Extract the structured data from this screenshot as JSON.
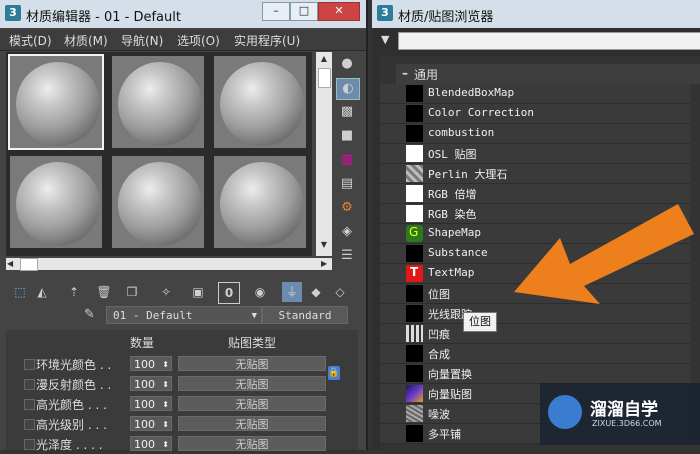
{
  "material_editor": {
    "title": "材质编辑器 - 01 - Default",
    "app_icon": "3",
    "menus": [
      "模式(D)",
      "材质(M)",
      "导航(N)",
      "选项(O)",
      "实用程序(U)"
    ],
    "material_name": "01 - Default",
    "material_type": "Standard",
    "params_header": {
      "amount": "数量",
      "map_type": "贴图类型"
    },
    "params": [
      {
        "label": "环境光颜色 . .",
        "amount": "100",
        "map": "无贴图"
      },
      {
        "label": "漫反射颜色 . .",
        "amount": "100",
        "map": "无贴图"
      },
      {
        "label": "高光颜色 . . .",
        "amount": "100",
        "map": "无贴图"
      },
      {
        "label": "高光级别 . . .",
        "amount": "100",
        "map": "无贴图"
      },
      {
        "label": "光泽度 . . . .",
        "amount": "100",
        "map": "无贴图"
      }
    ],
    "side_tools": [
      "sphere-icon",
      "backlight-icon",
      "checker-background-icon",
      "sample-uv-icon",
      "video-color-icon",
      "make-preview-icon",
      "options-icon",
      "select-by-material-icon",
      "material-navigator-icon"
    ],
    "toolbar_glyph": "0"
  },
  "browser": {
    "title": "材质/贴图浏览器",
    "app_icon": "3",
    "search_value": "",
    "category": "通用",
    "items": [
      {
        "label": "BlendedBoxMap",
        "icon": "black"
      },
      {
        "label": "Color Correction",
        "icon": "black"
      },
      {
        "label": "combustion",
        "icon": "black"
      },
      {
        "label": "OSL 贴图",
        "icon": "white"
      },
      {
        "label": "Perlin 大理石",
        "icon": "marble"
      },
      {
        "label": "RGB 倍增",
        "icon": "white"
      },
      {
        "label": "RGB 染色",
        "icon": "white"
      },
      {
        "label": "ShapeMap",
        "icon": "shapemap"
      },
      {
        "label": "Substance",
        "icon": "black"
      },
      {
        "label": "TextMap",
        "icon": "textmap"
      },
      {
        "label": "位图",
        "icon": "black"
      },
      {
        "label": "光线跟踪",
        "icon": "black"
      },
      {
        "label": "凹痕",
        "icon": "dent"
      },
      {
        "label": "合成",
        "icon": "black"
      },
      {
        "label": "向量置换",
        "icon": "black"
      },
      {
        "label": "向量贴图",
        "icon": "vector"
      },
      {
        "label": "噪波",
        "icon": "noise"
      },
      {
        "label": "多平铺",
        "icon": "black"
      }
    ],
    "tooltip": "位图",
    "textmap_glyph": "T"
  },
  "watermark": {
    "brand": "溜溜自学",
    "url": "ZIXUE.3D66.COM"
  },
  "colors": {
    "arrow": "#ee7f1d",
    "title_bar": "#d5dfe9"
  }
}
